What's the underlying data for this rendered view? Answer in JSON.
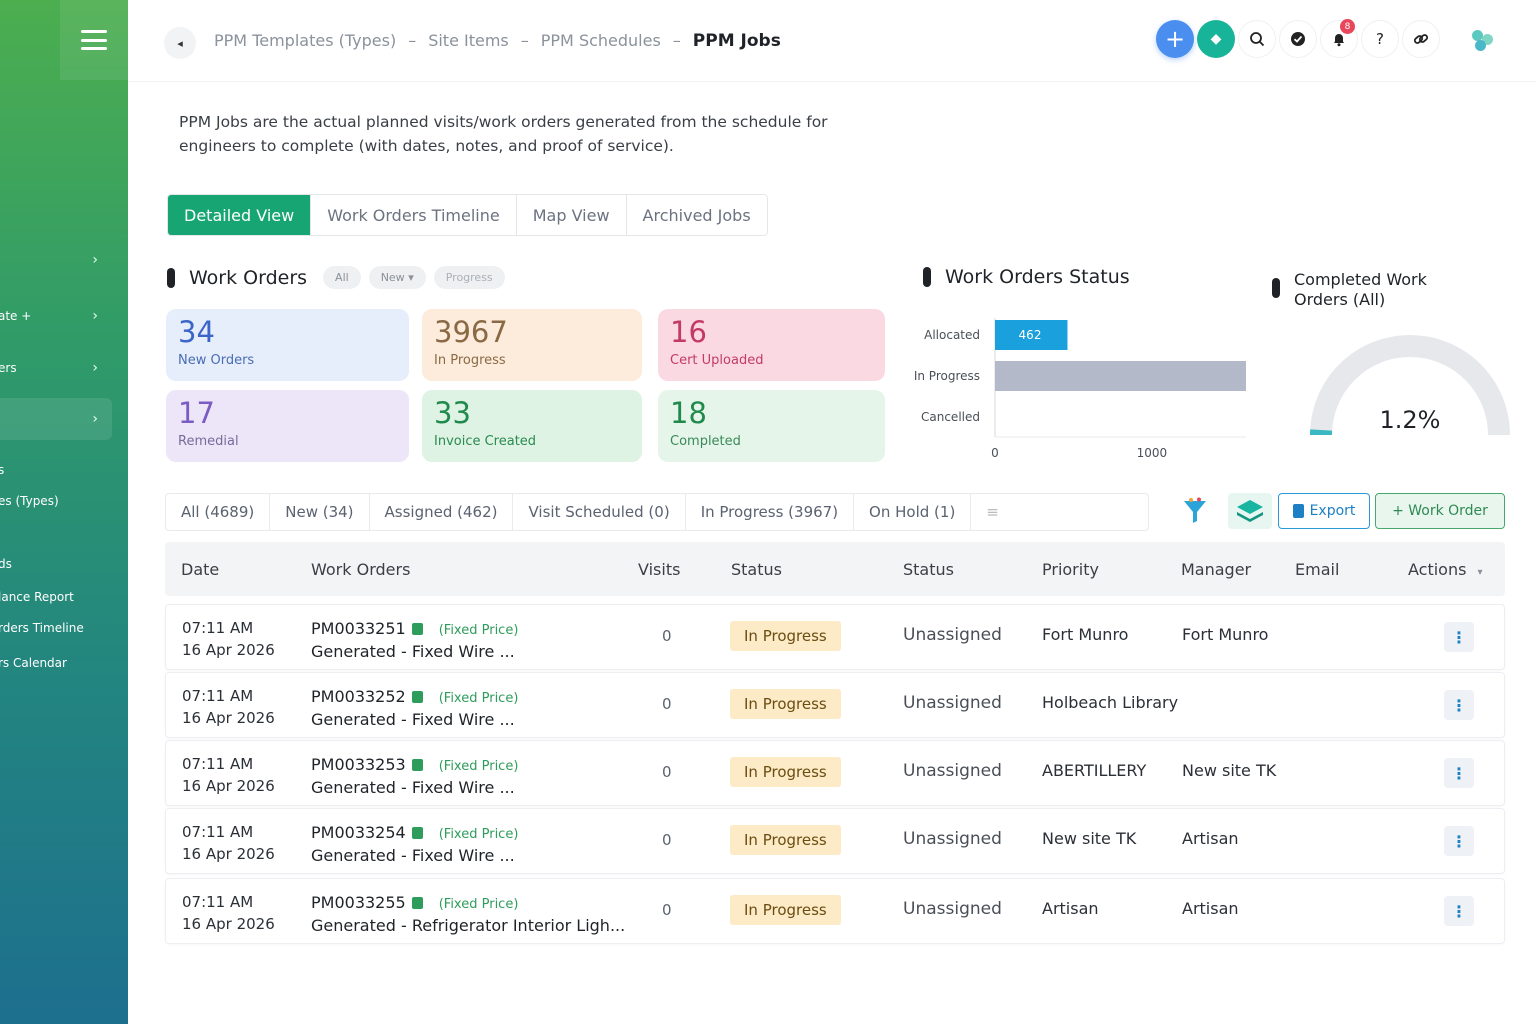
{
  "sidebar": {
    "items": [
      {
        "label": "",
        "y": 242
      },
      {
        "label": "ate +",
        "y": 298
      },
      {
        "label": "ers",
        "y": 350
      },
      {
        "label": "",
        "y": 400
      }
    ],
    "links": [
      "s",
      "es (Types)",
      "ds",
      "lance Report",
      "rders Timeline",
      "rs Calendar"
    ]
  },
  "header": {
    "breadcrumb": [
      "PPM Templates (Types)",
      "Site Items",
      "PPM Schedules"
    ],
    "current": "PPM Jobs",
    "notification_count": "8",
    "help_label": "?"
  },
  "description": "PPM Jobs are the actual planned visits/work orders generated from the schedule for engineers to complete (with dates, notes, and proof of service).",
  "tabs": [
    "Detailed View",
    "Work Orders Timeline",
    "Map View",
    "Archived Jobs"
  ],
  "work_orders": {
    "title": "Work Orders",
    "pills": [
      "All",
      "New",
      "Progress"
    ],
    "cards": [
      {
        "num": "34",
        "label": "New Orders"
      },
      {
        "num": "3967",
        "label": "In Progress"
      },
      {
        "num": "16",
        "label": "Cert Uploaded"
      },
      {
        "num": "17",
        "label": "Remedial"
      },
      {
        "num": "33",
        "label": "Invoice Created"
      },
      {
        "num": "18",
        "label": "Completed"
      }
    ]
  },
  "status_chart_title": "Work Orders Status",
  "chart_data": {
    "type": "bar",
    "orientation": "horizontal",
    "title": "Work Orders Status",
    "categories": [
      "Allocated",
      "In Progress",
      "Cancelled"
    ],
    "values": [
      462,
      1600,
      0
    ],
    "value_labels": [
      "462",
      "",
      ""
    ],
    "xlim": [
      0,
      1600
    ],
    "xticks": [
      "0",
      "1000"
    ],
    "colors": [
      "#1aa0dc",
      "#b3b9c8",
      "#b3b9c8"
    ]
  },
  "gauge": {
    "title": "Completed Work Orders (All)",
    "value_label": "1.2%",
    "value": 1.2
  },
  "filters": [
    "All (4689)",
    "New (34)",
    "Assigned (462)",
    "Visit Scheduled (0)",
    "In Progress (3967)",
    "On Hold (1)",
    "≡"
  ],
  "toolbar": {
    "export_label": "Export",
    "add_label": "+ Work Order"
  },
  "table": {
    "headers": [
      "Date",
      "Work Orders",
      "Visits",
      "Status",
      "Status",
      "Priority",
      "Manager",
      "Email",
      "Actions"
    ],
    "rows": [
      {
        "time": "07:11 AM",
        "date": "16 Apr 2026",
        "id": "PM0033251",
        "price": "(Fixed Price)",
        "desc": "Generated - Fixed Wire ...",
        "visits": "0",
        "status": "In Progress",
        "assignee": "Unassigned",
        "priority": "Fort Munro",
        "manager": "Fort Munro"
      },
      {
        "time": "07:11 AM",
        "date": "16 Apr 2026",
        "id": "PM0033252",
        "price": "(Fixed Price)",
        "desc": "Generated - Fixed Wire ...",
        "visits": "0",
        "status": "In Progress",
        "assignee": "Unassigned",
        "priority": "Holbeach Library",
        "manager": ""
      },
      {
        "time": "07:11 AM",
        "date": "16 Apr 2026",
        "id": "PM0033253",
        "price": "(Fixed Price)",
        "desc": "Generated - Fixed Wire ...",
        "visits": "0",
        "status": "In Progress",
        "assignee": "Unassigned",
        "priority": "ABERTILLERY",
        "manager": "New site TK"
      },
      {
        "time": "07:11 AM",
        "date": "16 Apr 2026",
        "id": "PM0033254",
        "price": "(Fixed Price)",
        "desc": "Generated - Fixed Wire ...",
        "visits": "0",
        "status": "In Progress",
        "assignee": "Unassigned",
        "priority": "New site TK",
        "manager": "Artisan"
      },
      {
        "time": "07:11 AM",
        "date": "16 Apr 2026",
        "id": "PM0033255",
        "price": "(Fixed Price)",
        "desc": "Generated - Refrigerator Interior Ligh...",
        "visits": "0",
        "status": "In Progress",
        "assignee": "Unassigned",
        "priority": "Artisan",
        "manager": "Artisan"
      }
    ]
  }
}
